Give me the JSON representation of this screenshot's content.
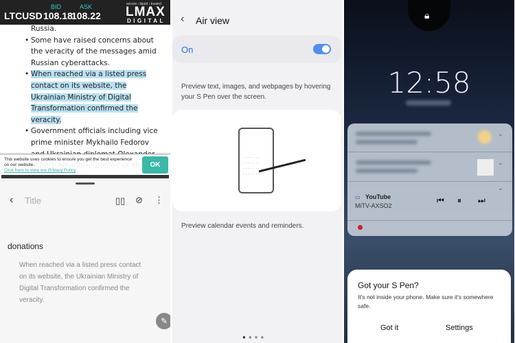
{
  "ticker": {
    "symbol": "LTCUSD",
    "bid_label": "BID",
    "ask_label": "ASK",
    "bid": "108.18",
    "ask": "108.22",
    "tagline": "secure › liquid › trusted",
    "logo": "LMAX",
    "logo_sub": "DIGITAL"
  },
  "article": {
    "items": [
      "Russia.",
      "Some have raised concerns about the veracity of the messages amid Russian cyberattacks.",
      "When reached via a listed press contact on its website, the Ukrainian Ministry of Digital Transformation confirmed the veracity.",
      "Government officials including vice prime minister Mykhailo Fedorov and Ukrainian diplomat Olexander Scherb have also posted or shared the addresses."
    ]
  },
  "cookie": {
    "text": "This website uses cookies to ensure you get the best experience on our website.",
    "link": "Click here to view our Privacy Policy",
    "ok": "OK"
  },
  "editor": {
    "title_placeholder": "Title",
    "heading": "donations",
    "quote": "When reached via a listed press contact on its website, the Ukrainian Ministry of Digital Transformation confirmed the veracity."
  },
  "airview": {
    "title": "Air view",
    "toggle_label": "On",
    "toggle_on": true,
    "desc1": "Preview text, images, and webpages by hovering your S Pen over the screen.",
    "desc2": "Preview calendar events and reminders.",
    "page_count": 4,
    "current_page": 1
  },
  "lockscreen": {
    "time": "12:58",
    "media": {
      "app": "YouTube",
      "device": "MiTV-AXSO2"
    },
    "dialog": {
      "title": "Got your S Pen?",
      "message": "It's not inside your phone. Make sure it's somewhere safe.",
      "got_it": "Got it",
      "settings": "Settings"
    }
  }
}
